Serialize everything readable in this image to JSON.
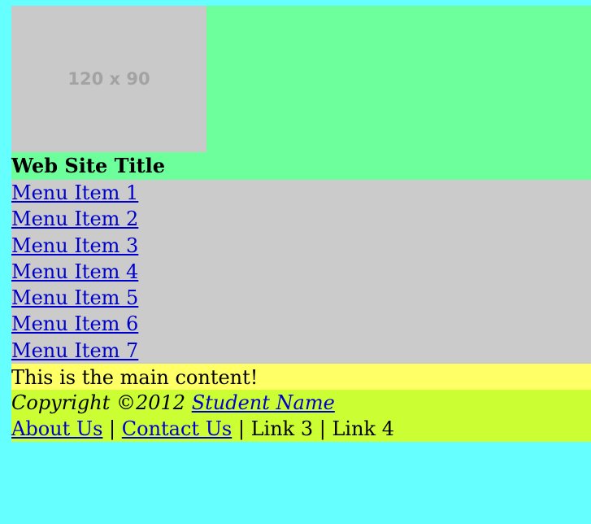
{
  "header": {
    "logo_placeholder": "120 x 90",
    "site_title": "Web Site Title"
  },
  "nav": {
    "items": [
      "Menu Item 1",
      "Menu Item 2",
      "Menu Item 3",
      "Menu Item 4",
      "Menu Item 5",
      "Menu Item 6",
      "Menu Item 7"
    ]
  },
  "main": {
    "text": "This is the main content!"
  },
  "footer": {
    "copyright_prefix": "Copyright ©2012 ",
    "author_link": "Student Name",
    "links": {
      "about": "About Us",
      "contact": "Contact Us",
      "link3": "Link 3",
      "link4": "Link 4",
      "separator": " | "
    }
  },
  "colors": {
    "header_bg": "#6dff9b",
    "logo_bg": "#c9c9c9",
    "nav_bg": "#cbcbcb",
    "main_bg": "#ffff66",
    "footer_bg": "#ccff33",
    "page_bg": "#66ffff",
    "link": "#0000cc"
  }
}
